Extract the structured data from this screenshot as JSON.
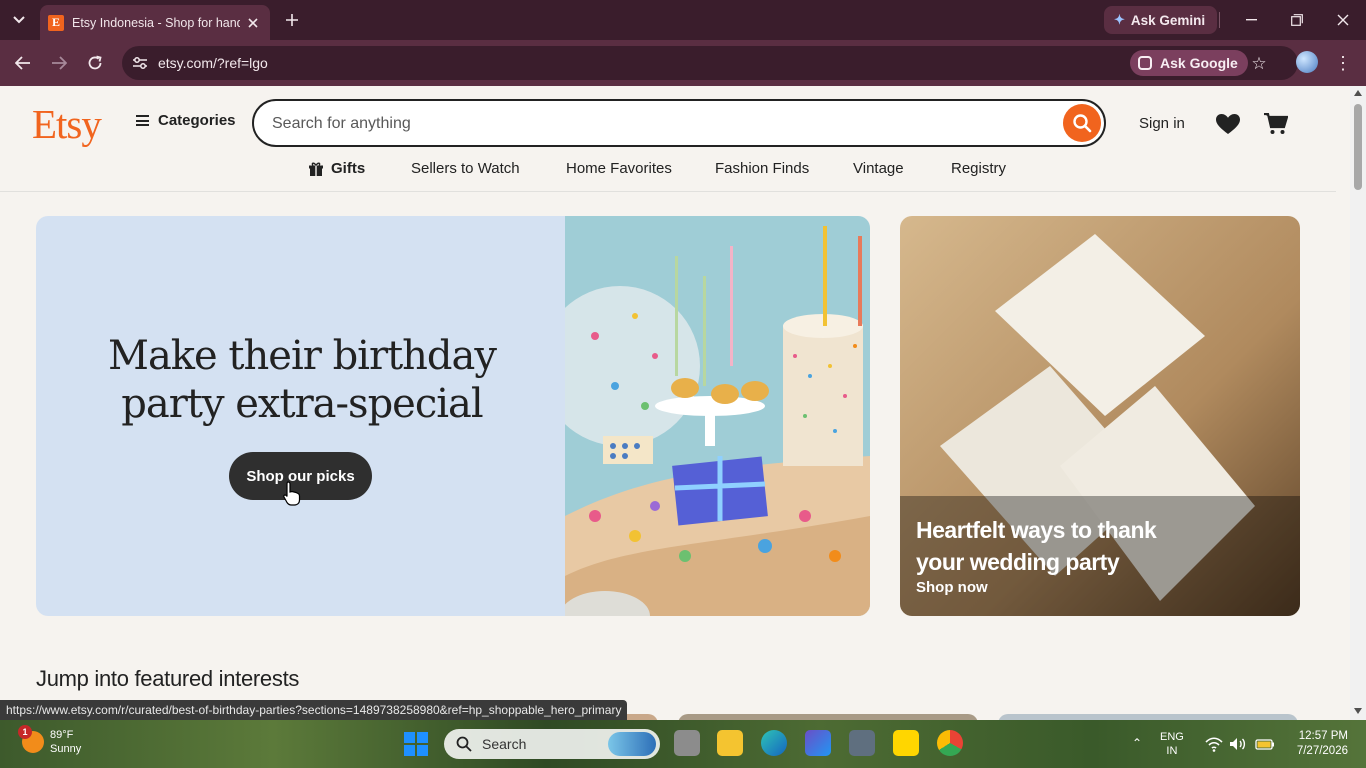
{
  "browser": {
    "tab_title": "Etsy Indonesia - Shop for handmade",
    "favicon_letter": "E",
    "ask_gemini_label": "Ask Gemini",
    "url": "etsy.com/?ref=lgo",
    "ask_google_label": "Ask Google",
    "status_url": "https://www.etsy.com/r/curated/best-of-birthday-parties?sections=1489738258980&ref=hp_shoppable_hero_primary"
  },
  "header": {
    "logo": "Etsy",
    "categories_label": "Categories",
    "search_placeholder": "Search for anything",
    "signin_label": "Sign in"
  },
  "subnav": {
    "items": [
      "Gifts",
      "Sellers to Watch",
      "Home Favorites",
      "Fashion Finds",
      "Vintage",
      "Registry"
    ]
  },
  "hero": {
    "title": "Make their birthday party extra-special",
    "button_label": "Shop our picks"
  },
  "side_card": {
    "title": "Heartfelt ways to thank your wedding party",
    "link_label": "Shop now"
  },
  "featured": {
    "title": "Jump into featured interests"
  },
  "taskbar": {
    "weather_temp": "89°F",
    "weather_desc": "Sunny",
    "weather_badge": "1",
    "search_label": "Search",
    "lang_line1": "ENG",
    "lang_line2": "IN",
    "time": "12:57 PM",
    "date": "7/27/2026"
  },
  "colors": {
    "etsy_orange": "#f1641e",
    "chrome_dark": "#3a1d2c",
    "chrome_mid": "#5a2e42",
    "hero_bg": "#d4e1f2"
  }
}
